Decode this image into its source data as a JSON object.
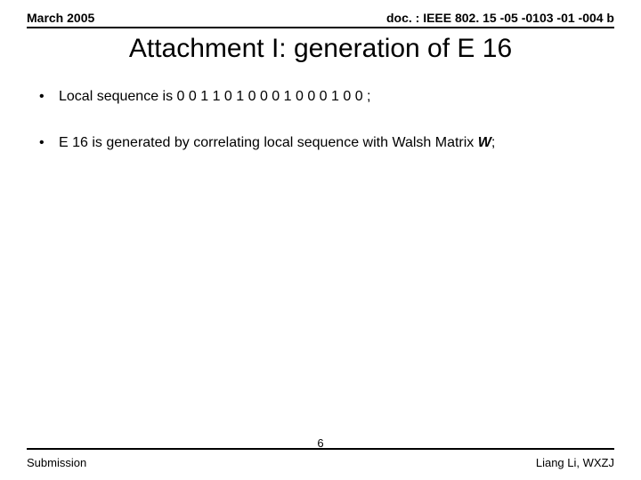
{
  "header": {
    "date": "March 2005",
    "doc": "doc. : IEEE 802. 15 -05 -0103 -01 -004 b"
  },
  "title": "Attachment I: generation of E 16",
  "bullets": [
    "Local sequence is 0 0 1 1 0 1 0 0 0 1 0 0 0 1 0 0 ;",
    "E 16 is generated by correlating local sequence with Walsh Matrix W;"
  ],
  "footer": {
    "left": "Submission",
    "page": "6",
    "right": "Liang Li, WXZJ"
  }
}
